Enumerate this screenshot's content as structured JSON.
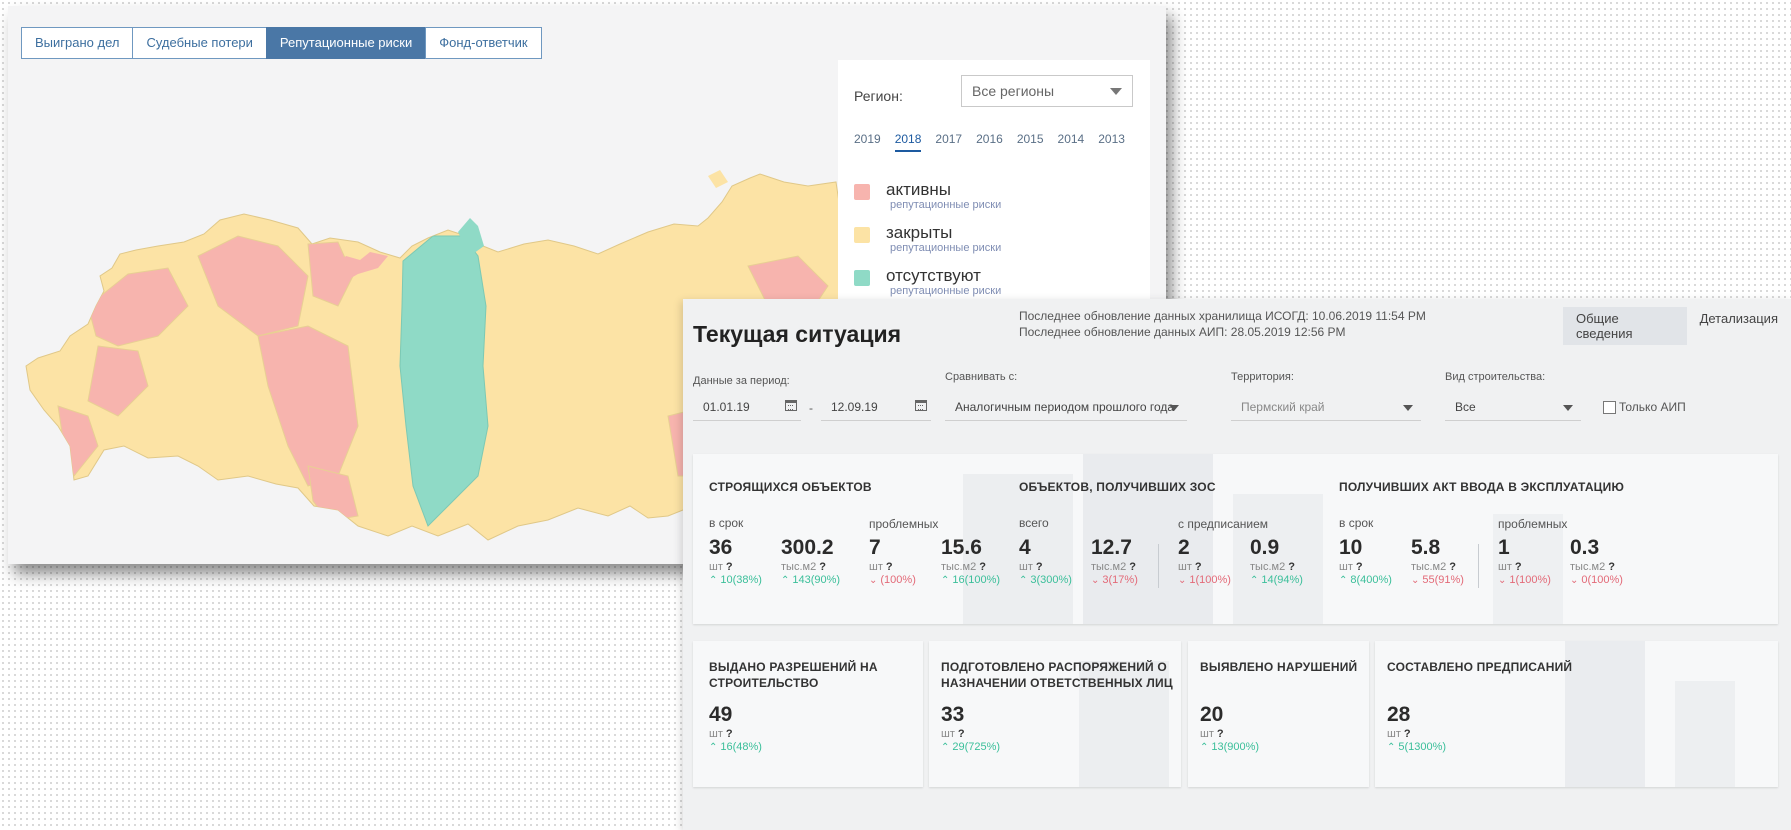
{
  "map_panel": {
    "tabs": [
      {
        "label": "Выиграно дел",
        "active": false
      },
      {
        "label": "Судебные потери",
        "active": false
      },
      {
        "label": "Репутационные риски",
        "active": true
      },
      {
        "label": "Фонд-ответчик",
        "active": false
      }
    ],
    "region_label": "Регион:",
    "region_value": "Все регионы",
    "years": [
      "2019",
      "2018",
      "2017",
      "2016",
      "2015",
      "2014",
      "2013"
    ],
    "active_year": "2018",
    "legend": [
      {
        "title": "активны",
        "sub": "репутационные риски",
        "color": "#f7b4ae"
      },
      {
        "title": "закрыты",
        "sub": "репутационные риски",
        "color": "#fce3a5"
      },
      {
        "title": "отсутствуют",
        "sub": "репутационные риски",
        "color": "#8fdac6"
      }
    ]
  },
  "dashboard": {
    "title": "Текущая ситуация",
    "update_line1": "Последнее обновление данных хранилища ИСОГД: 10.06.2019 11:54 PM",
    "update_line2": "Последнее обновление данных АИП: 28.05.2019 12:56 PM",
    "view_tabs": [
      {
        "label": "Общие сведения",
        "active": true
      },
      {
        "label": "Детализация",
        "active": false
      }
    ],
    "filters": {
      "period_label": "Данные за период:",
      "date_from": "01.01.19",
      "date_sep": "-",
      "date_to": "12.09.19",
      "compare_label": "Сравнивать с:",
      "compare_value": "Аналогичным периодом прошлого года",
      "territory_label": "Территория:",
      "territory_value": "Пермский край",
      "type_label": "Вид строительства:",
      "type_value": "Все",
      "only_aip_label": "Только АИП"
    },
    "q": "?",
    "up_arrow": "⌃",
    "down_arrow": "⌄",
    "card1": {
      "titles": [
        "СТРОЯЩИХСЯ ОБЪЕКТОВ",
        "ОБЪЕКТОВ, ПОЛУЧИВШИХ ЗОС",
        "ПОЛУЧИВШИХ АКТ ВВОДА В ЭКСПЛУАТАЦИЮ"
      ],
      "subs": [
        "в срок",
        "проблемных",
        "всего",
        "с предписанием",
        "в срок",
        "проблемных"
      ],
      "metrics": [
        {
          "value": "36",
          "unit": "шт",
          "delta": "10(38%)",
          "dir": "up"
        },
        {
          "value": "300.2",
          "unit": "тыс.м2",
          "delta": "143(90%)",
          "dir": "up"
        },
        {
          "value": "7",
          "unit": "шт",
          "delta": "(100%)",
          "dir": "down"
        },
        {
          "value": "15.6",
          "unit": "тыс.м2",
          "delta": "16(100%)",
          "dir": "up"
        },
        {
          "value": "4",
          "unit": "шт",
          "delta": "3(300%)",
          "dir": "up"
        },
        {
          "value": "12.7",
          "unit": "тыс.м2",
          "delta": "3(17%)",
          "dir": "down"
        },
        {
          "value": "2",
          "unit": "шт",
          "delta": "1(100%)",
          "dir": "down"
        },
        {
          "value": "0.9",
          "unit": "тыс.м2",
          "delta": "14(94%)",
          "dir": "up"
        },
        {
          "value": "10",
          "unit": "шт",
          "delta": "8(400%)",
          "dir": "up"
        },
        {
          "value": "5.8",
          "unit": "тыс.м2",
          "delta": "55(91%)",
          "dir": "down"
        },
        {
          "value": "1",
          "unit": "шт",
          "delta": "1(100%)",
          "dir": "down"
        },
        {
          "value": "0.3",
          "unit": "тыс.м2",
          "delta": "0(100%)",
          "dir": "down"
        }
      ]
    },
    "small_cards": [
      {
        "title": "ВЫДАНО РАЗРЕШЕНИЙ НА СТРОИТЕЛЬСТВО",
        "value": "49",
        "unit": "шт",
        "delta": "16(48%)",
        "dir": "up"
      },
      {
        "title": "ПОДГОТОВЛЕНО РАСПОРЯЖЕНИЙ О НАЗНАЧЕНИИ ОТВЕТСТВЕННЫХ ЛИЦ",
        "value": "33",
        "unit": "шт",
        "delta": "29(725%)",
        "dir": "up"
      },
      {
        "title": "ВЫЯВЛЕНО НАРУШЕНИЙ",
        "value": "20",
        "unit": "шт",
        "delta": "13(900%)",
        "dir": "up"
      },
      {
        "title": "СОСТАВЛЕНО ПРЕДПИСАНИЙ",
        "value": "28",
        "unit": "шт",
        "delta": "5(1300%)",
        "dir": "up"
      }
    ]
  }
}
